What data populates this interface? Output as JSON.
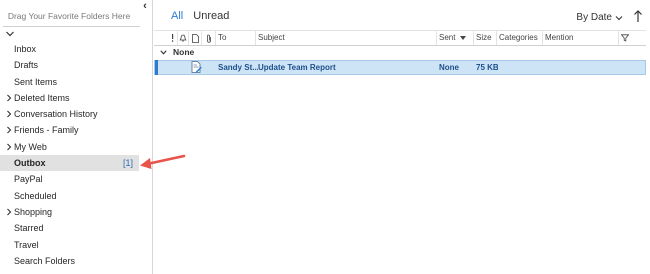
{
  "sidebar": {
    "drag_hint": "Drag Your Favorite Folders Here",
    "folders": [
      {
        "label": "Inbox"
      },
      {
        "label": "Drafts"
      },
      {
        "label": "Sent Items"
      },
      {
        "label": "Deleted Items",
        "expandable": true
      },
      {
        "label": "Conversation History",
        "expandable": true
      },
      {
        "label": "Friends - Family",
        "expandable": true
      },
      {
        "label": "My Web",
        "expandable": true
      },
      {
        "label": "Outbox",
        "selected": true,
        "count": "[1]"
      },
      {
        "label": "PayPal"
      },
      {
        "label": "Scheduled"
      },
      {
        "label": "Shopping",
        "expandable": true
      },
      {
        "label": "Starred"
      },
      {
        "label": "Travel"
      },
      {
        "label": "Search Folders"
      }
    ]
  },
  "toolbar": {
    "tabs": [
      {
        "label": "All",
        "active": true
      },
      {
        "label": "Unread"
      }
    ],
    "sort_label": "By Date"
  },
  "columns": {
    "to": "To",
    "subject": "Subject",
    "sent": "Sent",
    "size": "Size",
    "categories": "Categories",
    "mention": "Mention"
  },
  "group": {
    "label": "None"
  },
  "messages": [
    {
      "to": "Sandy St...",
      "subject": "Update Team Report",
      "sent": "None",
      "size": "75 KB"
    }
  ],
  "colors": {
    "accent": "#2b7bd0",
    "selected_row": "#cde4f7",
    "annotation": "#e8534a"
  }
}
